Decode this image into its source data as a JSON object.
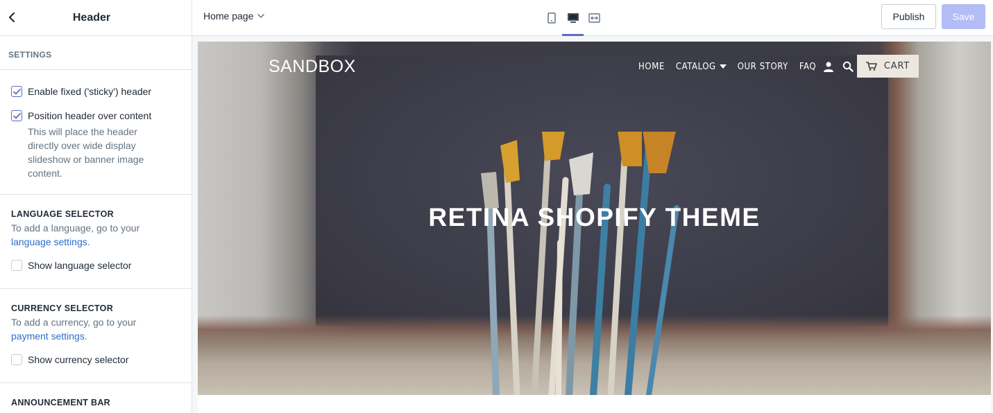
{
  "sidebar": {
    "title": "Header",
    "settings_caption": "SETTINGS",
    "sticky_label": "Enable fixed ('sticky') header",
    "position_label": "Position header over content",
    "position_help": "This will place the header directly over wide display slideshow or banner image content.",
    "language": {
      "caption": "LANGUAGE SELECTOR",
      "help_prefix": "To add a language, go to your",
      "link": "language settings",
      "suffix": ".",
      "checkbox_label": "Show language selector"
    },
    "currency": {
      "caption": "CURRENCY SELECTOR",
      "help_prefix": "To add a currency, go to your",
      "link": "payment settings",
      "suffix": ".",
      "checkbox_label": "Show currency selector"
    },
    "announcement_caption": "ANNOUNCEMENT BAR"
  },
  "toolbar": {
    "page_select": "Home page",
    "publish_label": "Publish",
    "save_label": "Save"
  },
  "store": {
    "logo": "SANDBOX",
    "menu": [
      "HOME",
      "CATALOG",
      "OUR STORY",
      "FAQ"
    ],
    "cart_label": "CART",
    "hero_title": "RETINA SHOPIFY THEME"
  },
  "colors": {
    "accent": "#5c6ac4",
    "link": "#2c6ecb",
    "save_disabled": "#b3bcf5"
  }
}
